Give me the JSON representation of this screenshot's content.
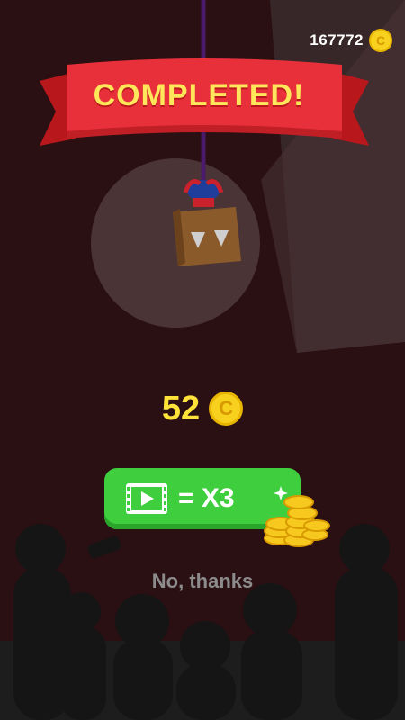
{
  "hud": {
    "coin_balance": "167772",
    "coin_symbol": "C"
  },
  "banner": {
    "title": "COMPLETED!"
  },
  "reward": {
    "amount": "52",
    "coin_symbol": "C"
  },
  "ad_offer": {
    "label": "= X3",
    "icon": "video-icon"
  },
  "skip": {
    "label": "No, thanks"
  },
  "colors": {
    "banner_red": "#e8303a",
    "title_yellow": "#ffe65a",
    "button_green": "#3fcf3e",
    "coin_gold": "#f7d11e"
  }
}
